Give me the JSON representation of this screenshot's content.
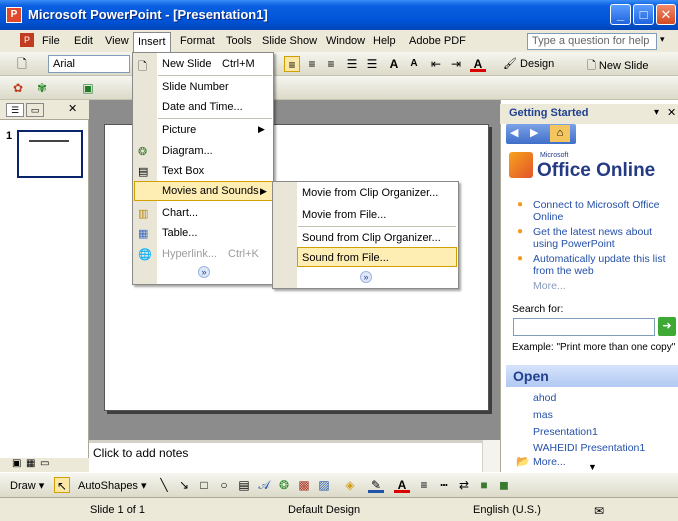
{
  "window": {
    "title": "Microsoft PowerPoint - [Presentation1]"
  },
  "menubar": {
    "items": [
      "File",
      "Edit",
      "View",
      "Insert",
      "Format",
      "Tools",
      "Slide Show",
      "Window",
      "Help",
      "Adobe PDF"
    ],
    "help_placeholder": "Type a question for help"
  },
  "toolbar": {
    "font": "Arial",
    "design_label": "Design",
    "new_slide_label": "New Slide"
  },
  "insert_menu": {
    "new_slide": "New Slide",
    "new_slide_shortcut": "Ctrl+M",
    "slide_number": "Slide Number",
    "date_time": "Date and Time...",
    "picture": "Picture",
    "diagram": "Diagram...",
    "text_box": "Text Box",
    "movies_sounds": "Movies and Sounds",
    "chart": "Chart...",
    "table": "Table...",
    "hyperlink": "Hyperlink...",
    "hyperlink_shortcut": "Ctrl+K"
  },
  "movies_submenu": {
    "movie_clip": "Movie from Clip Organizer...",
    "movie_file": "Movie from File...",
    "sound_clip": "Sound from Clip Organizer...",
    "sound_file": "Sound from File..."
  },
  "slides_pane": {
    "slide_number": "1"
  },
  "notes": {
    "placeholder": "Click to add notes"
  },
  "taskpane": {
    "title": "Getting Started",
    "office_small": "Microsoft",
    "office_online": "Office Online",
    "links": [
      "Connect to Microsoft Office Online",
      "Get the latest news about using PowerPoint",
      "Automatically update this list from the web"
    ],
    "more": "More...",
    "search_label": "Search for:",
    "example": "Example: \"Print more than one copy\"",
    "open_header": "Open",
    "open_items": [
      "ahod",
      "mas",
      "Presentation1",
      "WAHEIDI Presentation1"
    ],
    "open_more": "More..."
  },
  "draw_toolbar": {
    "draw": "Draw",
    "autoshapes": "AutoShapes"
  },
  "statusbar": {
    "slide": "Slide 1 of 1",
    "design": "Default Design",
    "language": "English (U.S.)"
  }
}
